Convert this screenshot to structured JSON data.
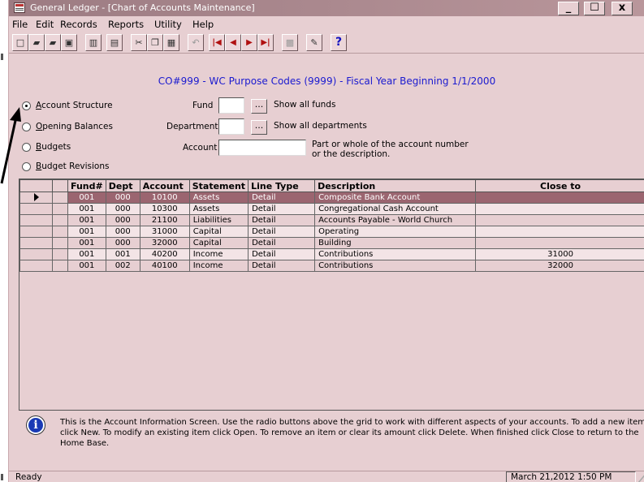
{
  "window": {
    "title": "General Ledger - [Chart of Accounts Maintenance]",
    "minimize": "_",
    "maximize": "☐",
    "close": "x"
  },
  "menu": [
    "File",
    "Edit",
    "Records",
    "Reports",
    "Utility",
    "Help"
  ],
  "toolbar": {
    "icons": [
      "new-icon",
      "open-folder-icon",
      "open-folder-2-icon",
      "save-icon",
      "delete-icon",
      "print-icon",
      "cut-icon",
      "copy-icon",
      "paste-icon",
      "undo-icon",
      "first-record-icon",
      "previous-record-icon",
      "next-record-icon",
      "last-record-icon",
      "calculator-icon",
      "notes-icon",
      "help-icon"
    ]
  },
  "heading": "CO#999 - WC Purpose Codes (9999) - Fiscal Year Beginning 1/1/2000",
  "views": [
    {
      "label": "Account Structure",
      "accel": "A",
      "rest": "ccount Structure",
      "checked": true
    },
    {
      "label": "Opening Balances",
      "accel": "O",
      "rest": "pening Balances",
      "checked": false
    },
    {
      "label": "Budgets",
      "accel": "B",
      "rest": "udgets",
      "checked": false
    },
    {
      "label": "Budget Revisions",
      "accel": "B",
      "rest": "udget Revisions",
      "checked": false
    }
  ],
  "filters": {
    "fund_label": "Fund",
    "fund_value": "",
    "fund_button": "...",
    "fund_note": "Show all funds",
    "dept_label": "Department",
    "dept_value": "",
    "dept_button": "...",
    "dept_note": "Show all departments",
    "account_label": "Account",
    "account_value": "",
    "account_note_1": "Part or whole of the account number",
    "account_note_2": "or the description."
  },
  "grid": {
    "columns": [
      "Fund#",
      "Dept",
      "Account",
      "Statement",
      "Line Type",
      "Description",
      "Close to"
    ],
    "rows": [
      {
        "fund": "001",
        "dept": "000",
        "account": "10100",
        "statement": "Assets",
        "line_type": "Detail",
        "description": "Composite Bank Account",
        "close_to": "",
        "selected": true
      },
      {
        "fund": "001",
        "dept": "000",
        "account": "10300",
        "statement": "Assets",
        "line_type": "Detail",
        "description": "Congregational Cash Account",
        "close_to": ""
      },
      {
        "fund": "001",
        "dept": "000",
        "account": "21100",
        "statement": "Liabilities",
        "line_type": "Detail",
        "description": "Accounts Payable - World Church",
        "close_to": ""
      },
      {
        "fund": "001",
        "dept": "000",
        "account": "31000",
        "statement": "Capital",
        "line_type": "Detail",
        "description": "Operating",
        "close_to": ""
      },
      {
        "fund": "001",
        "dept": "000",
        "account": "32000",
        "statement": "Capital",
        "line_type": "Detail",
        "description": "Building",
        "close_to": ""
      },
      {
        "fund": "001",
        "dept": "001",
        "account": "40200",
        "statement": "Income",
        "line_type": "Detail",
        "description": "Contributions",
        "close_to": "31000"
      },
      {
        "fund": "001",
        "dept": "002",
        "account": "40100",
        "statement": "Income",
        "line_type": "Detail",
        "description": "Contributions",
        "close_to": "32000"
      }
    ]
  },
  "info": "This is the Account Information Screen.  Use the radio buttons above the grid to work with different aspects of your accounts.  To add a new item click New.  To modify an existing item click Open.  To remove an item or clear its amount click Delete.  When finished click Close to return to the Home Base.",
  "status": {
    "ready": "Ready",
    "datetime": "March 21,2012 1:50 PM"
  },
  "colors": {
    "background": "#e7cfd2",
    "selected_row": "#9b6570",
    "heading": "#1a1ad0"
  }
}
